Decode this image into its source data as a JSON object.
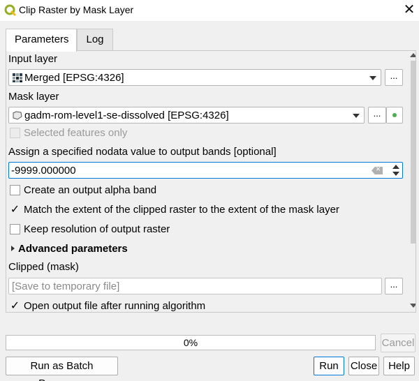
{
  "window": {
    "title": "Clip Raster by Mask Layer",
    "close_glyph": "✕"
  },
  "tabs": [
    {
      "label": "Parameters",
      "active": true
    },
    {
      "label": "Log",
      "active": false
    }
  ],
  "params": {
    "input_layer_label": "Input layer",
    "input_layer_value": "Merged [EPSG:4326]",
    "mask_layer_label": "Mask layer",
    "mask_layer_value": "gadm-rom-level1-se-dissolved [EPSG:4326]",
    "selected_only_label": "Selected features only",
    "nodata_label": "Assign a specified nodata value to output bands [optional]",
    "nodata_value": "-9999.000000",
    "alpha_band_label": "Create an output alpha band",
    "match_extent_label": "Match the extent of the clipped raster to the extent of the mask layer",
    "keep_resolution_label": "Keep resolution of output raster",
    "advanced_label": "Advanced parameters",
    "clipped_label": "Clipped (mask)",
    "clipped_placeholder": "[Save to temporary file]",
    "open_output_label": "Open output file after running algorithm",
    "ellipsis": "...",
    "checkmark": "✓"
  },
  "progress": {
    "text": "0%",
    "value": 0
  },
  "buttons": {
    "cancel": "Cancel",
    "batch": "Run as Batch Process...",
    "run": "Run",
    "close": "Close",
    "help": "Help"
  }
}
